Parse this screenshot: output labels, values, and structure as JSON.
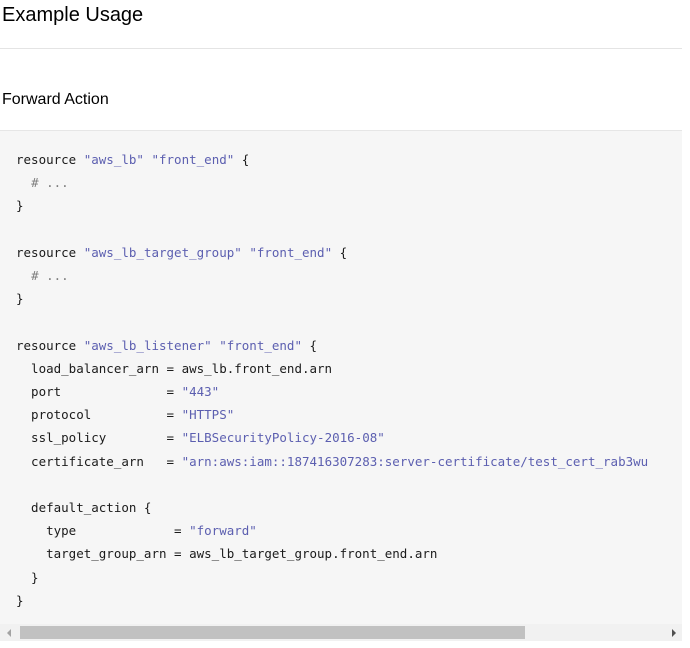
{
  "page": {
    "heading": "Example Usage"
  },
  "section": {
    "heading": "Forward Action"
  },
  "code": {
    "language": "hcl",
    "lines": [
      [
        {
          "t": "resource "
        },
        {
          "t": "\"aws_lb\"",
          "c": "str"
        },
        {
          "t": " "
        },
        {
          "t": "\"front_end\"",
          "c": "str"
        },
        {
          "t": " {"
        }
      ],
      [
        {
          "t": "  "
        },
        {
          "t": "# ...",
          "c": "cmt"
        }
      ],
      [
        {
          "t": "}"
        }
      ],
      [],
      [
        {
          "t": "resource "
        },
        {
          "t": "\"aws_lb_target_group\"",
          "c": "str"
        },
        {
          "t": " "
        },
        {
          "t": "\"front_end\"",
          "c": "str"
        },
        {
          "t": " {"
        }
      ],
      [
        {
          "t": "  "
        },
        {
          "t": "# ...",
          "c": "cmt"
        }
      ],
      [
        {
          "t": "}"
        }
      ],
      [],
      [
        {
          "t": "resource "
        },
        {
          "t": "\"aws_lb_listener\"",
          "c": "str"
        },
        {
          "t": " "
        },
        {
          "t": "\"front_end\"",
          "c": "str"
        },
        {
          "t": " {"
        }
      ],
      [
        {
          "t": "  load_balancer_arn = aws_lb.front_end.arn"
        }
      ],
      [
        {
          "t": "  port              = "
        },
        {
          "t": "\"443\"",
          "c": "str"
        }
      ],
      [
        {
          "t": "  protocol          = "
        },
        {
          "t": "\"HTTPS\"",
          "c": "str"
        }
      ],
      [
        {
          "t": "  ssl_policy        = "
        },
        {
          "t": "\"ELBSecurityPolicy-2016-08\"",
          "c": "str"
        }
      ],
      [
        {
          "t": "  certificate_arn   = "
        },
        {
          "t": "\"arn:aws:iam::187416307283:server-certificate/test_cert_rab3wu",
          "c": "str"
        }
      ],
      [],
      [
        {
          "t": "  default_action {"
        }
      ],
      [
        {
          "t": "    type             = "
        },
        {
          "t": "\"forward\"",
          "c": "str"
        }
      ],
      [
        {
          "t": "    target_group_arn = aws_lb_target_group.front_end.arn"
        }
      ],
      [
        {
          "t": "  }"
        }
      ],
      [
        {
          "t": "}"
        }
      ]
    ]
  },
  "scrollbar": {
    "position": 0.0,
    "visible_fraction": 0.78
  },
  "icons": {
    "scroll_left": "scroll-left-arrow-icon",
    "scroll_right": "scroll-right-arrow-icon"
  },
  "colors": {
    "string": "#5c5fb0",
    "comment": "#7d7d7d",
    "code_background": "#f6f6f6"
  }
}
